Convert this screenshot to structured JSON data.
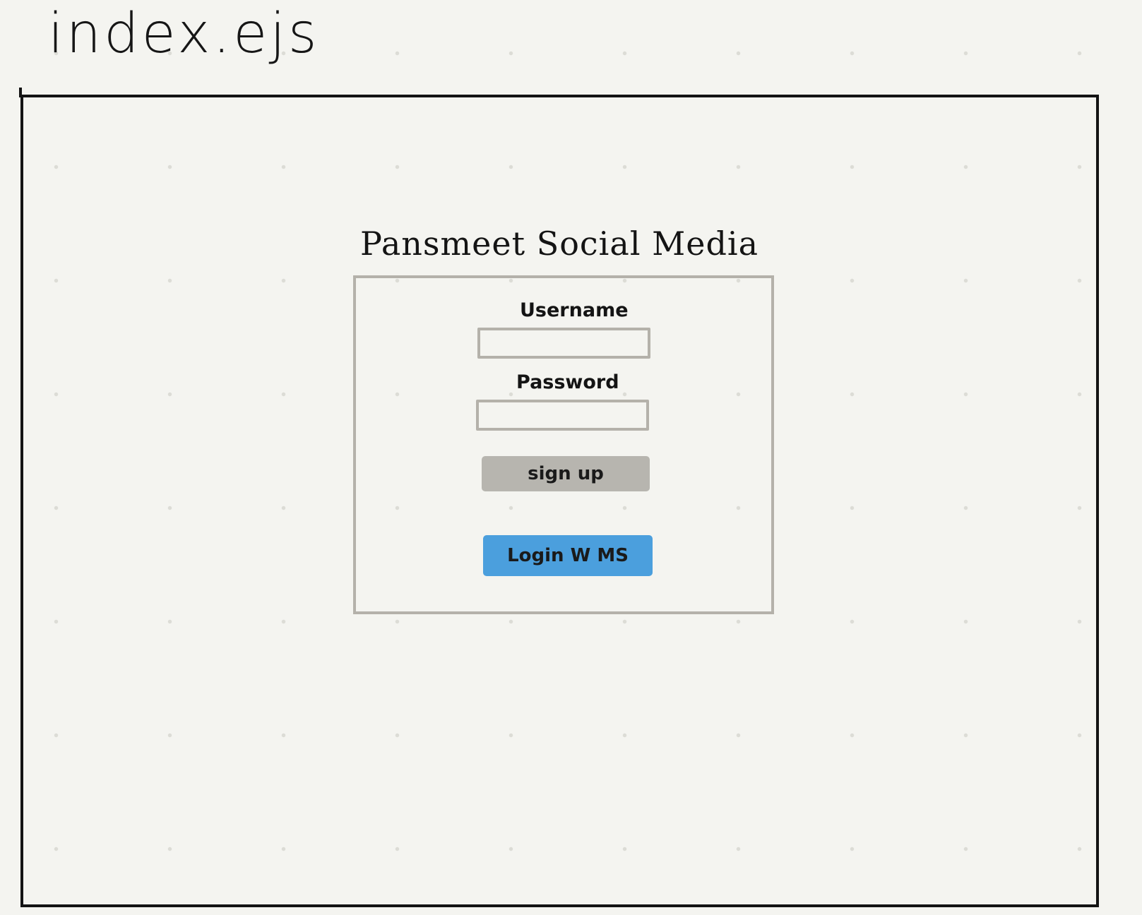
{
  "file_title": "index.ejs",
  "app_title": "Pansmeet Social Media",
  "login_form": {
    "username_label": "Username",
    "username_value": "",
    "password_label": "Password",
    "password_value": "",
    "signup_label": "sign up",
    "ms_login_label": "Login W MS"
  },
  "colors": {
    "background": "#f4f4f0",
    "frame": "#141414",
    "card_border": "#b4b1aa",
    "signup_button": "#b7b5af",
    "ms_button": "#4b9fdd"
  }
}
